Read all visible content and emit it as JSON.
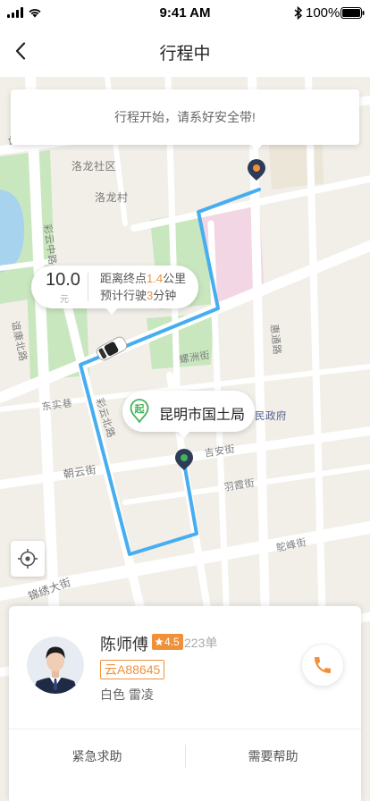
{
  "status_bar": {
    "time": "9:41 AM",
    "battery_text": "100%",
    "icons": [
      "signal-icon",
      "wifi-icon",
      "bluetooth-icon",
      "battery-icon"
    ]
  },
  "nav": {
    "title": "行程中",
    "back_icon": "chevron-left-icon"
  },
  "banner": {
    "text": "行程开始，请系好安全带!"
  },
  "trip_info": {
    "fare": "10.0",
    "fare_unit": "元",
    "distance_prefix": "距离终点",
    "distance_value": "1.4",
    "distance_unit": "公里",
    "eta_prefix": "预计行驶",
    "eta_value": "3",
    "eta_unit": "分钟"
  },
  "start_point": {
    "badge": "起",
    "name": "昆明市国土局"
  },
  "map": {
    "labels": [
      "石",
      "洛龙社区",
      "洛龙村",
      "彩云中路",
      "谊康北路",
      "东实巷",
      "彩云北路",
      "朝云街",
      "锦绣大街",
      "螺洲街",
      "吉安街",
      "羽霞街",
      "鸵峰街",
      "民政府",
      "惠通路"
    ],
    "locate_icon": "crosshair-icon",
    "vehicle_icon": "car-icon"
  },
  "driver": {
    "name": "陈师傅",
    "rating": "4.5",
    "orders": "223单",
    "plate": "云A88645",
    "vehicle": "白色 雷凌",
    "call_icon": "phone-icon"
  },
  "actions": {
    "emergency": "紧急求助",
    "help": "需要帮助"
  },
  "colors": {
    "accent": "#f0913a",
    "route": "#46aef0",
    "start": "#41b35a",
    "marker": "#2f3c58",
    "park": "#c9e7bf",
    "water": "#a7d3ef",
    "area": "#f3d6e3"
  }
}
